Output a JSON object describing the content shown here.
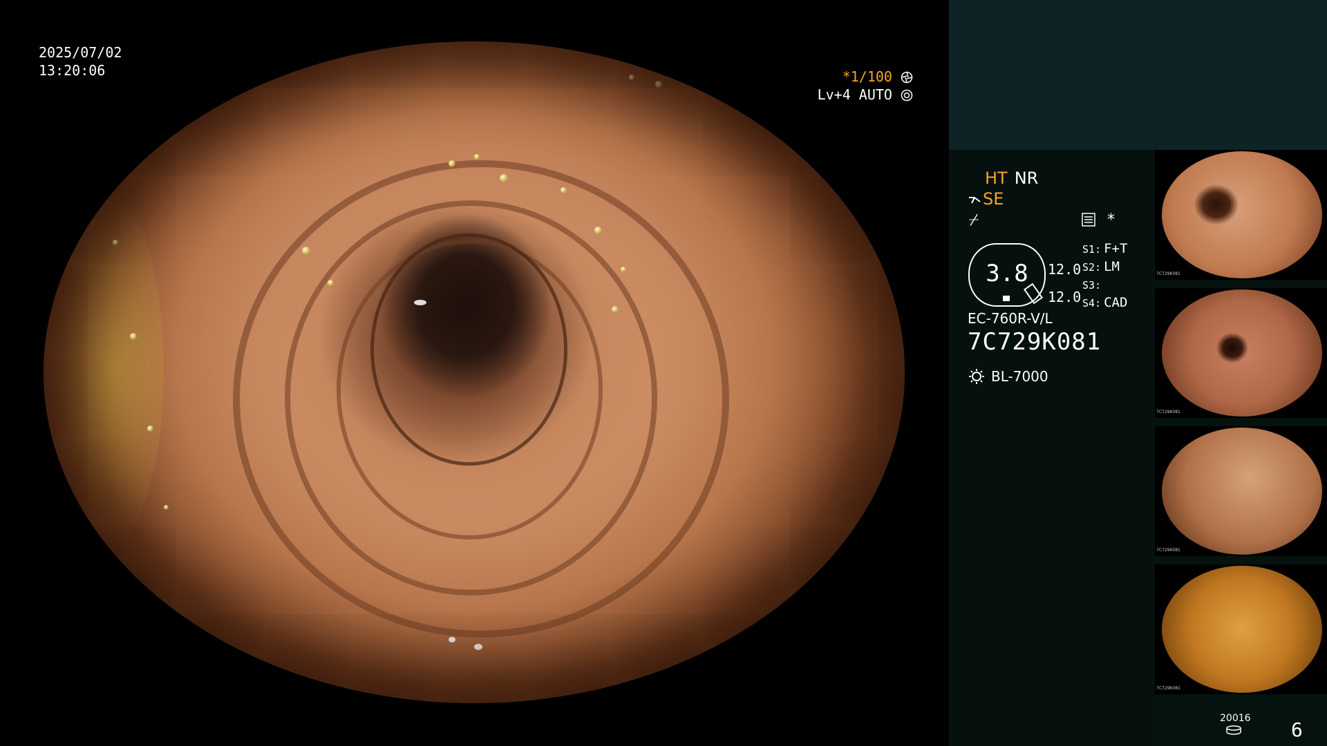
{
  "overlay": {
    "date": "2025/07/02",
    "time": "13:20:06",
    "shutter": "*1/100",
    "light_level": "Lv+4 AUTO"
  },
  "settings": {
    "ht": "HT",
    "nr": "NR",
    "se": "SE",
    "enhance_symbol": "⌿",
    "star": "*"
  },
  "zoom": {
    "value": "3.8"
  },
  "lens_values": [
    "12.0",
    "12.0"
  ],
  "switches": [
    {
      "key": "S1:",
      "value": "F+T"
    },
    {
      "key": "S2:",
      "value": "LM"
    },
    {
      "key": "S3:",
      "value": ""
    },
    {
      "key": "S4:",
      "value": "CAD"
    }
  ],
  "scope": {
    "model": "EC-760R-V/L",
    "serial": "7C729K081"
  },
  "light_source": {
    "name": "BL-7000",
    "icon": "light-source-icon"
  },
  "storage": {
    "code": "20016",
    "icon": "storage-disk-icon",
    "image_count": "6"
  },
  "thumbnails": [
    {
      "label": "7C729K081"
    },
    {
      "label": "7C729K081"
    },
    {
      "label": "7C729K081"
    },
    {
      "label": "7C729K081"
    }
  ],
  "colors": {
    "accent_orange": "#f5a623",
    "top_panel": "#0d2326",
    "side_panel": "#05100f"
  }
}
